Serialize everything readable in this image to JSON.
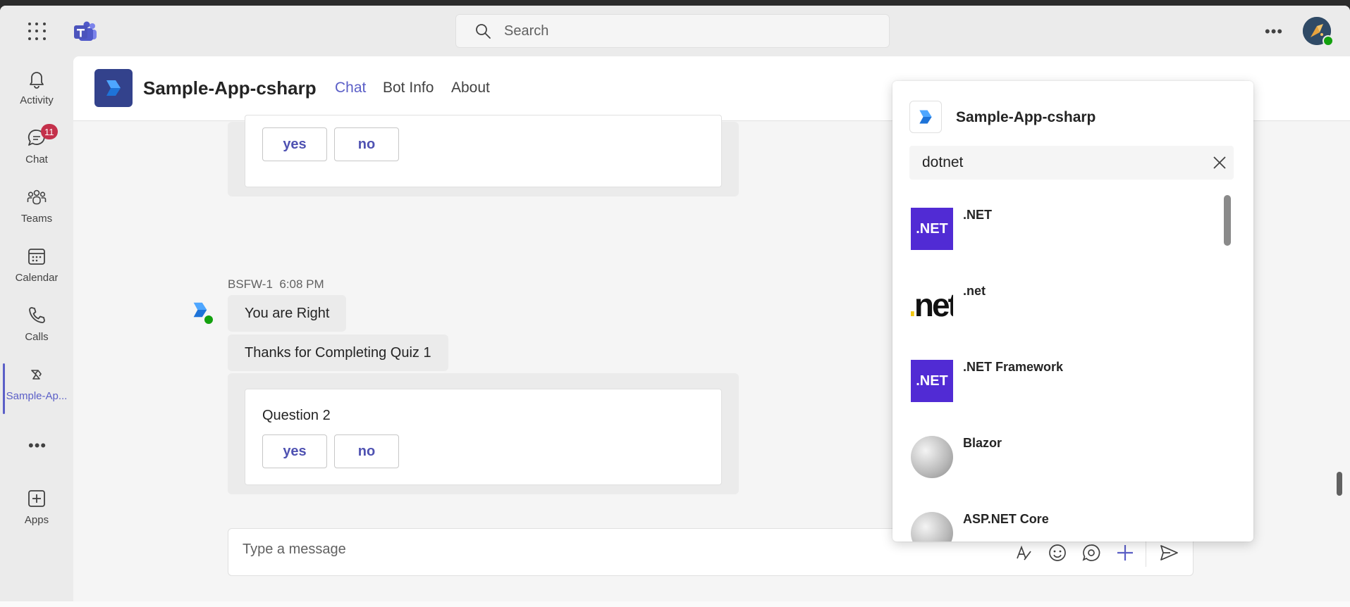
{
  "topbar": {
    "search_placeholder": "Search"
  },
  "rail": {
    "items": [
      {
        "label": "Activity",
        "icon": "bell-icon"
      },
      {
        "label": "Chat",
        "icon": "chat-icon",
        "badge": "11"
      },
      {
        "label": "Teams",
        "icon": "teams-icon"
      },
      {
        "label": "Calendar",
        "icon": "calendar-icon"
      },
      {
        "label": "Calls",
        "icon": "phone-icon"
      },
      {
        "label": "Sample-Ap...",
        "icon": "app-icon",
        "active": true
      },
      {
        "label": "Apps",
        "icon": "add-app-icon"
      }
    ]
  },
  "header": {
    "app_title": "Sample-App-csharp",
    "tabs": [
      {
        "label": "Chat",
        "active": true
      },
      {
        "label": "Bot Info"
      },
      {
        "label": "About"
      }
    ]
  },
  "chat": {
    "card1": {
      "yes": "yes",
      "no": "no"
    },
    "sender": "BSFW-1",
    "time": "6:08 PM",
    "messages": [
      "You are Right",
      "Thanks for Completing Quiz 1"
    ],
    "card2": {
      "question": "Question 2",
      "yes": "yes",
      "no": "no"
    },
    "compose_placeholder": "Type a message"
  },
  "popup": {
    "title": "Sample-App-csharp",
    "search_value": "dotnet",
    "results": [
      {
        "name": ".NET",
        "thumb_text": ".NET"
      },
      {
        "name": ".net",
        "thumb_text": ".net"
      },
      {
        "name": ".NET Framework",
        "thumb_text": ".NET"
      },
      {
        "name": "Blazor",
        "thumb_text": ""
      },
      {
        "name": "ASP.NET Core",
        "thumb_text": ""
      }
    ]
  },
  "colors": {
    "accent": "#5b5fc7",
    "badge": "#c4314b",
    "presence": "#13a10e",
    "dotnet_purple": "#512bd4"
  }
}
